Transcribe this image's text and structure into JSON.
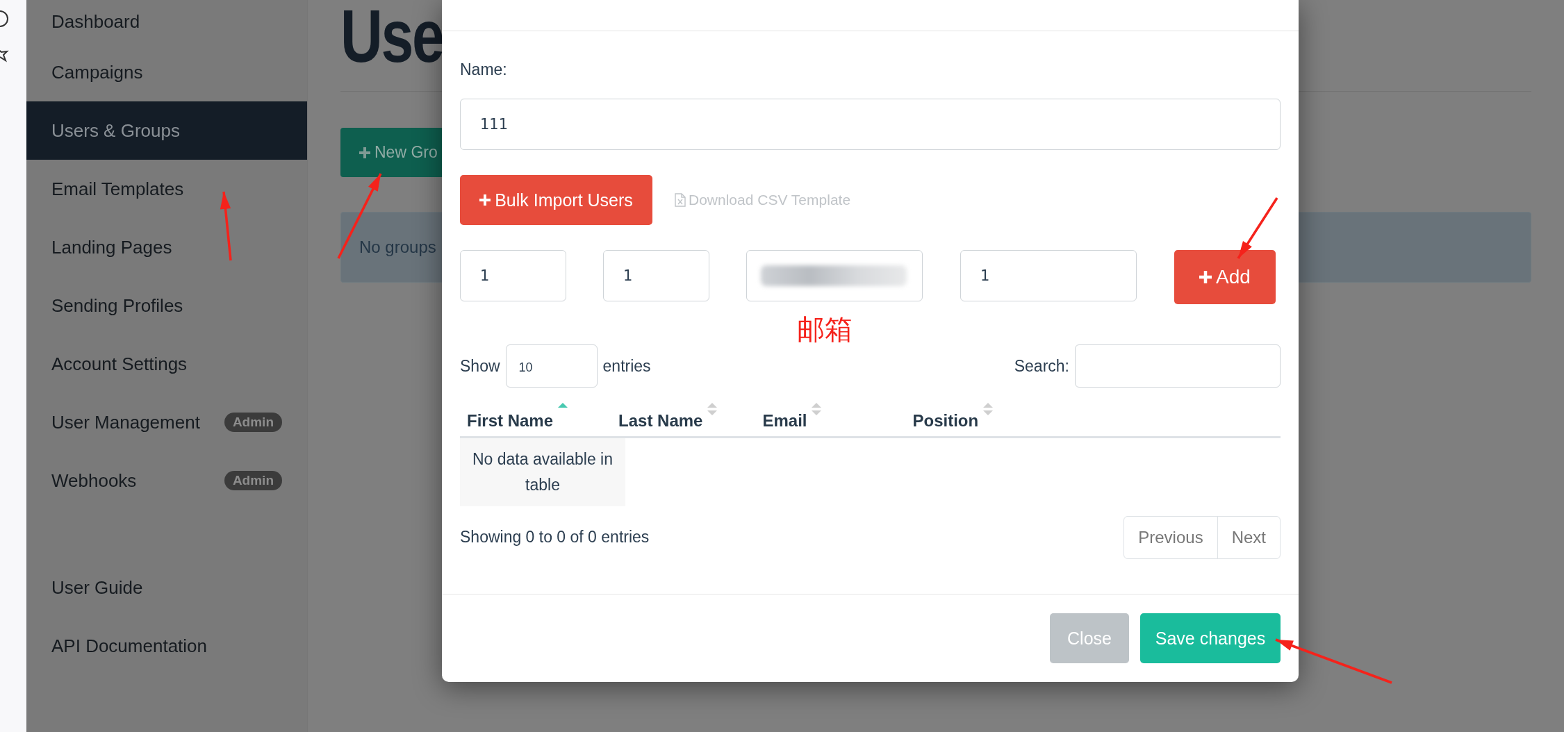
{
  "sidebar": {
    "items": [
      {
        "label": "Dashboard",
        "selected": false
      },
      {
        "label": "Campaigns",
        "selected": false
      },
      {
        "label": "Users & Groups",
        "selected": true
      },
      {
        "label": "Email Templates",
        "selected": false
      },
      {
        "label": "Landing Pages",
        "selected": false
      },
      {
        "label": "Sending Profiles",
        "selected": false
      },
      {
        "label": "Account Settings",
        "selected": false
      },
      {
        "label": "User Management",
        "selected": false,
        "badge": "Admin"
      },
      {
        "label": "Webhooks",
        "selected": false,
        "badge": "Admin"
      }
    ],
    "footer_items": [
      {
        "label": "User Guide"
      },
      {
        "label": "API Documentation"
      }
    ]
  },
  "page": {
    "title": "Use",
    "new_button": "New Gro",
    "alert": "No groups"
  },
  "modal": {
    "name_label": "Name:",
    "name_value": "111",
    "bulk_button": "Bulk Import Users",
    "csv_link": "Download CSV Template",
    "member_inputs": [
      {
        "kind": "text",
        "value": "1"
      },
      {
        "kind": "text",
        "value": "1"
      },
      {
        "kind": "blurred"
      },
      {
        "kind": "text",
        "value": "1"
      }
    ],
    "add_button": "Add",
    "show_label": "Show",
    "show_value": "10",
    "entries_label": "entries",
    "search_label": "Search:",
    "columns": [
      {
        "label": "First Name",
        "sorted": true
      },
      {
        "label": "Last Name",
        "sorted": false
      },
      {
        "label": "Email",
        "sorted": false
      },
      {
        "label": "Position",
        "sorted": false
      }
    ],
    "empty_text": "No data available in table",
    "info": "Showing 0 to 0 of 0 entries",
    "pagination": [
      {
        "label": "Previous"
      },
      {
        "label": "Next"
      }
    ],
    "close_button": "Close",
    "save_button": "Save changes"
  },
  "annotations": {
    "note": "邮箱"
  }
}
